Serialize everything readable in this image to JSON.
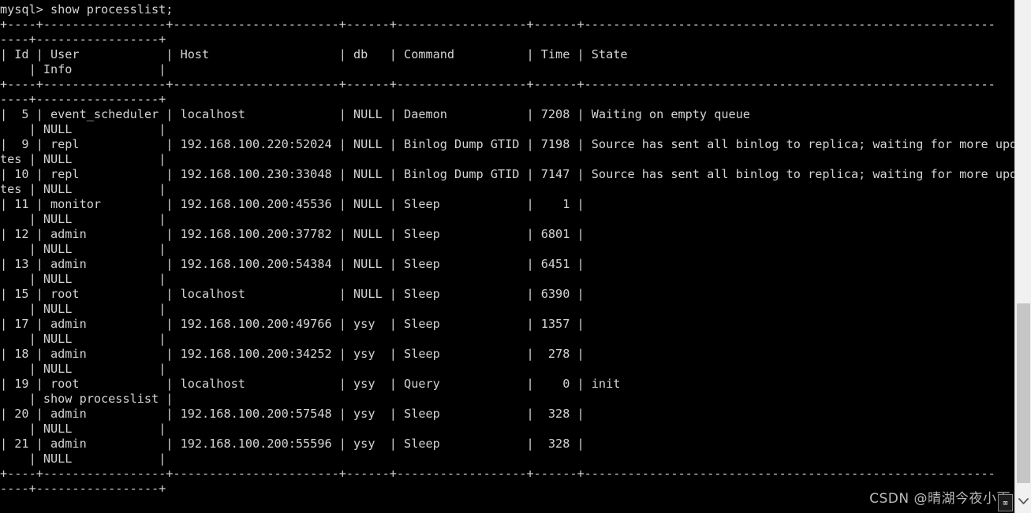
{
  "terminal": {
    "prompt_line": "mysql> show processlist;",
    "prompt": "mysql>",
    "command": "show processlist;",
    "background_color": "#000000",
    "text_color": "#d4d4d4",
    "columns": [
      "Id",
      "User",
      "Host",
      "db",
      "Command",
      "Time",
      "State",
      "Info"
    ],
    "border_rule_top": "+----+-----------------+-----------------------+------+------------------+------+--------------------------------------------------------",
    "border_rule_wrap": "----+-----------------+",
    "lines": [
      "mysql> show processlist;",
      "+----+-----------------+-----------------------+------+------------------+------+---------------------------------------------------------",
      "----+-----------------+",
      "| Id | User            | Host                  | db   | Command          | Time | State                                                   ",
      "    | Info            |",
      "+----+-----------------+-----------------------+------+------------------+------+---------------------------------------------------------",
      "----+-----------------+",
      "|  5 | event_scheduler | localhost             | NULL | Daemon           | 7208 | Waiting on empty queue                                  ",
      "    | NULL            |",
      "|  9 | repl            | 192.168.100.220:52024 | NULL | Binlog Dump GTID | 7198 | Source has sent all binlog to replica; waiting for more upda",
      "tes | NULL            |",
      "| 10 | repl            | 192.168.100.230:33048 | NULL | Binlog Dump GTID | 7147 | Source has sent all binlog to replica; waiting for more upda",
      "tes | NULL            |",
      "| 11 | monitor         | 192.168.100.200:45536 | NULL | Sleep            |    1 |                                                         ",
      "    | NULL            |",
      "| 12 | admin           | 192.168.100.200:37782 | NULL | Sleep            | 6801 |                                                         ",
      "    | NULL            |",
      "| 13 | admin           | 192.168.100.200:54384 | NULL | Sleep            | 6451 |                                                         ",
      "    | NULL            |",
      "| 15 | root            | localhost             | NULL | Sleep            | 6390 |                                                         ",
      "    | NULL            |",
      "| 17 | admin           | 192.168.100.200:49766 | ysy  | Sleep            | 1357 |                                                         ",
      "    | NULL            |",
      "| 18 | admin           | 192.168.100.200:34252 | ysy  | Sleep            |  278 |                                                         ",
      "    | NULL            |",
      "| 19 | root            | localhost             | ysy  | Query            |    0 | init                                                    ",
      "    | show processlist |",
      "| 20 | admin           | 192.168.100.200:57548 | ysy  | Sleep            |  328 |                                                         ",
      "    | NULL            |",
      "| 21 | admin           | 192.168.100.200:55596 | ysy  | Sleep            |  328 |                                                         ",
      "    | NULL            |",
      "+----+-----------------+-----------------------+------+------------------+------+---------------------------------------------------------",
      "----+-----------------+"
    ]
  },
  "processlist": {
    "headers": [
      "Id",
      "User",
      "Host",
      "db",
      "Command",
      "Time",
      "State",
      "Info"
    ],
    "rows": [
      {
        "Id": "5",
        "User": "event_scheduler",
        "Host": "localhost",
        "db": "NULL",
        "Command": "Daemon",
        "Time": "7208",
        "State": "Waiting on empty queue",
        "Info": "NULL"
      },
      {
        "Id": "9",
        "User": "repl",
        "Host": "192.168.100.220:52024",
        "db": "NULL",
        "Command": "Binlog Dump GTID",
        "Time": "7198",
        "State": "Source has sent all binlog to replica; waiting for more updates",
        "Info": "NULL"
      },
      {
        "Id": "10",
        "User": "repl",
        "Host": "192.168.100.230:33048",
        "db": "NULL",
        "Command": "Binlog Dump GTID",
        "Time": "7147",
        "State": "Source has sent all binlog to replica; waiting for more updates",
        "Info": "NULL"
      },
      {
        "Id": "11",
        "User": "monitor",
        "Host": "192.168.100.200:45536",
        "db": "NULL",
        "Command": "Sleep",
        "Time": "1",
        "State": "",
        "Info": "NULL"
      },
      {
        "Id": "12",
        "User": "admin",
        "Host": "192.168.100.200:37782",
        "db": "NULL",
        "Command": "Sleep",
        "Time": "6801",
        "State": "",
        "Info": "NULL"
      },
      {
        "Id": "13",
        "User": "admin",
        "Host": "192.168.100.200:54384",
        "db": "NULL",
        "Command": "Sleep",
        "Time": "6451",
        "State": "",
        "Info": "NULL"
      },
      {
        "Id": "15",
        "User": "root",
        "Host": "localhost",
        "db": "NULL",
        "Command": "Sleep",
        "Time": "6390",
        "State": "",
        "Info": "NULL"
      },
      {
        "Id": "17",
        "User": "admin",
        "Host": "192.168.100.200:49766",
        "db": "ysy",
        "Command": "Sleep",
        "Time": "1357",
        "State": "",
        "Info": "NULL"
      },
      {
        "Id": "18",
        "User": "admin",
        "Host": "192.168.100.200:34252",
        "db": "ysy",
        "Command": "Sleep",
        "Time": "278",
        "State": "",
        "Info": "NULL"
      },
      {
        "Id": "19",
        "User": "root",
        "Host": "localhost",
        "db": "ysy",
        "Command": "Query",
        "Time": "0",
        "State": "init",
        "Info": "show processlist"
      },
      {
        "Id": "20",
        "User": "admin",
        "Host": "192.168.100.200:57548",
        "db": "ysy",
        "Command": "Sleep",
        "Time": "328",
        "State": "",
        "Info": "NULL"
      },
      {
        "Id": "21",
        "User": "admin",
        "Host": "192.168.100.200:55596",
        "db": "ysy",
        "Command": "Sleep",
        "Time": "328",
        "State": "",
        "Info": "NULL"
      }
    ]
  },
  "watermark": {
    "text": "CSDN @晴湖今夜小雨",
    "color": "#b9b9b9"
  },
  "scrollbar": {
    "orientation": "vertical",
    "down_arrow_icon": "chevron-down-icon",
    "track_color": "#f1f1f1",
    "thumb_color": "#c6c6c6"
  },
  "corner_badge": {
    "label": "⌧"
  }
}
